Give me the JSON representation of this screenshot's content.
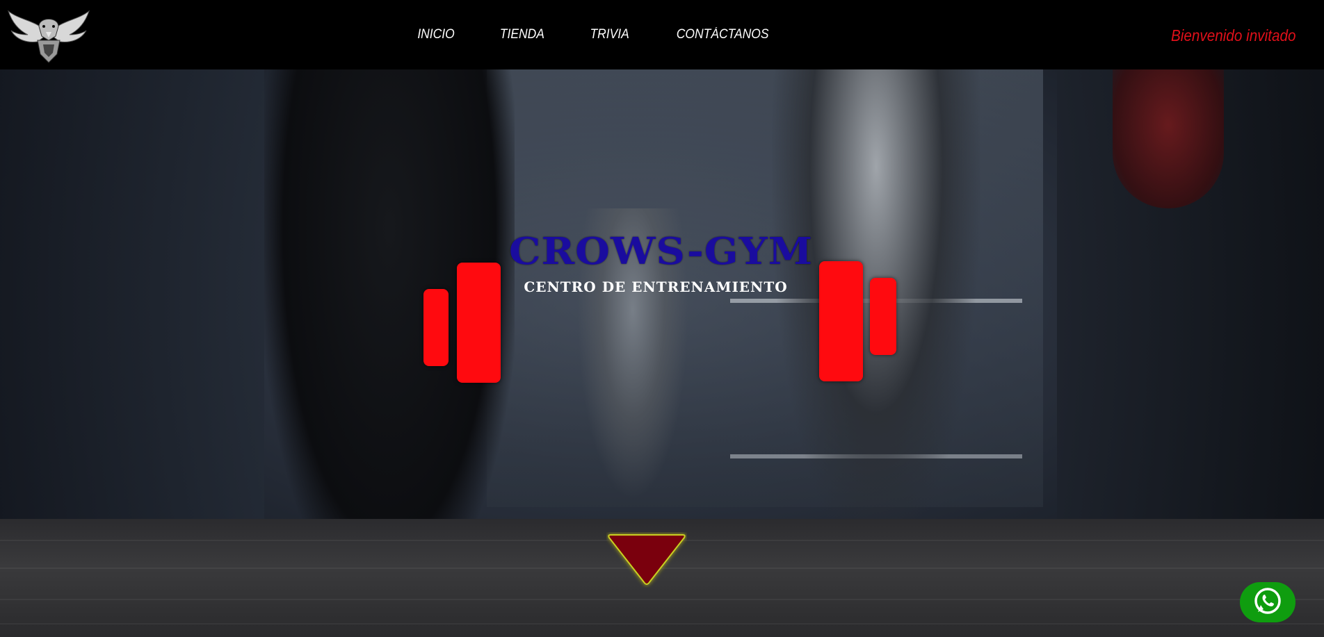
{
  "header": {
    "logo_icon": "eagle-logo-icon",
    "nav": [
      {
        "label": "INICIO"
      },
      {
        "label": "TIENDA"
      },
      {
        "label": "TRIVIA"
      },
      {
        "label": "CONTÁCTANOS"
      }
    ],
    "welcome_text": "Bienvenido invitado"
  },
  "hero": {
    "title": "CROWS-GYM",
    "subtitle": "CENTRO DE ENTRENAMIENTO",
    "scroll_icon": "triangle-down-icon"
  },
  "whatsapp": {
    "icon": "whatsapp-icon"
  },
  "colors": {
    "header_bg": "#000000",
    "welcome": "#e0101a",
    "title": "#1a0c9e",
    "plates": "#ff0a0f",
    "arrow": "#7a0008",
    "arrow_glow": "#c8d020",
    "whatsapp": "#0f9d0f"
  }
}
